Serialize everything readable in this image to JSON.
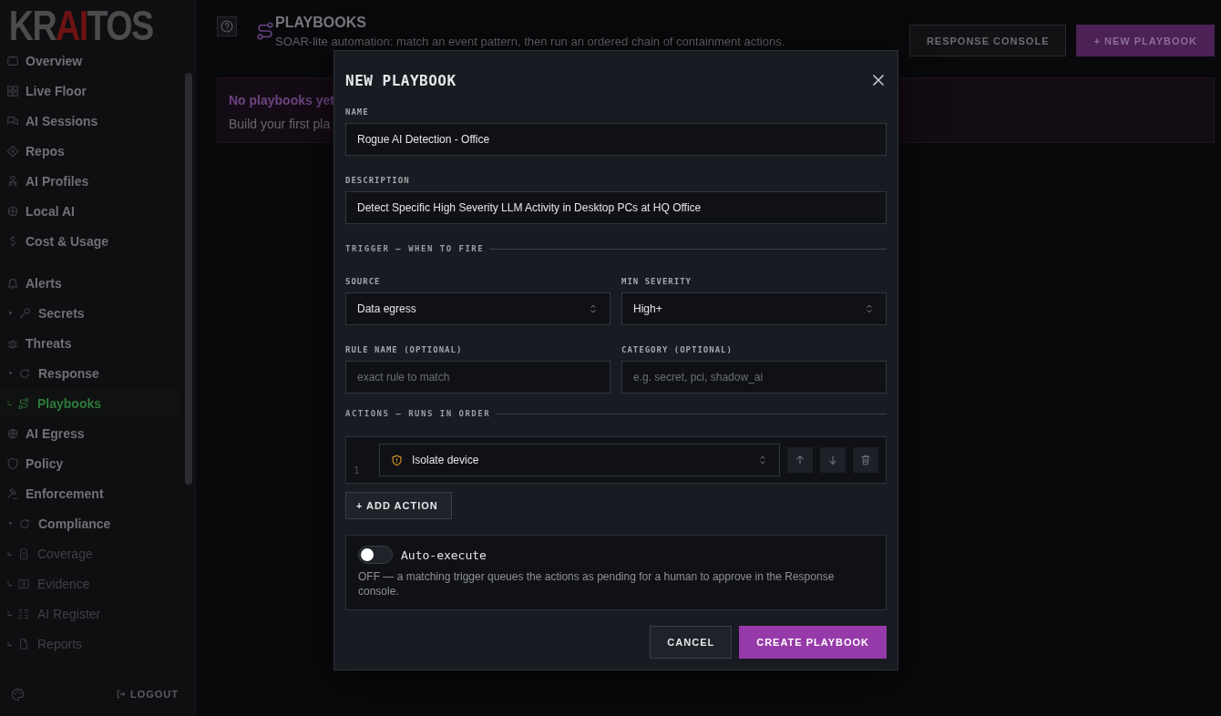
{
  "logo": {
    "parts": [
      {
        "text": "KR",
        "accent": false
      },
      {
        "text": "AI",
        "accent": true
      },
      {
        "text": "TOS",
        "accent": false
      }
    ]
  },
  "sidebar": {
    "sections": [
      {
        "items": [
          {
            "label": "Overview",
            "kind": "item",
            "selected": false
          },
          {
            "label": "Live Floor",
            "kind": "item",
            "selected": false
          },
          {
            "label": "AI Sessions",
            "kind": "item",
            "selected": false
          },
          {
            "label": "Repos",
            "kind": "item",
            "selected": false
          },
          {
            "label": "AI Profiles",
            "kind": "item",
            "selected": false
          },
          {
            "label": "Local AI",
            "kind": "item",
            "selected": false
          },
          {
            "label": "Cost & Usage",
            "kind": "item",
            "selected": false
          }
        ]
      },
      {
        "items": [
          {
            "label": "Alerts",
            "kind": "item",
            "selected": false
          },
          {
            "label": "Secrets",
            "kind": "group",
            "selected": false,
            "expanded": false
          },
          {
            "label": "Threats",
            "kind": "item",
            "selected": false
          },
          {
            "label": "Response",
            "kind": "group",
            "selected": false,
            "expanded": true
          },
          {
            "label": "Playbooks",
            "kind": "child",
            "selected": true
          },
          {
            "label": "AI Egress",
            "kind": "item",
            "selected": false
          },
          {
            "label": "Policy",
            "kind": "item",
            "selected": false
          },
          {
            "label": "Enforcement",
            "kind": "item",
            "selected": false
          },
          {
            "label": "Compliance",
            "kind": "group",
            "selected": false,
            "expanded": true
          },
          {
            "label": "Coverage",
            "kind": "child",
            "selected": false
          },
          {
            "label": "Evidence",
            "kind": "child",
            "selected": false
          },
          {
            "label": "AI Register",
            "kind": "child",
            "selected": false
          },
          {
            "label": "Reports",
            "kind": "child",
            "selected": false
          }
        ]
      }
    ],
    "logout": "LOGOUT"
  },
  "header": {
    "title": "PLAYBOOKS",
    "subtitle": "SOAR-lite automation: match an event pattern, then run an ordered chain of containment actions.",
    "buttons": [
      {
        "label": "RESPONSE CONSOLE",
        "kind": "secondary"
      },
      {
        "label": "+ NEW PLAYBOOK",
        "kind": "primary"
      }
    ]
  },
  "banner": {
    "title": "No playbooks yet",
    "text": "Build your first pla"
  },
  "dialog": {
    "title": "NEW PLAYBOOK",
    "name": {
      "label": "NAME",
      "value": "Rogue AI Detection - Office"
    },
    "description": {
      "label": "DESCRIPTION",
      "value": "Detect Specific High Severity LLM Activity in Desktop PCs at HQ Office"
    },
    "trigger_heading": "TRIGGER — WHEN TO FIRE",
    "trigger_fields": [
      {
        "label": "SOURCE",
        "kind": "select",
        "value": "Data egress"
      },
      {
        "label": "MIN SEVERITY",
        "kind": "select",
        "value": "High+"
      },
      {
        "label": "RULE NAME (OPTIONAL)",
        "kind": "text",
        "placeholder": "exact rule to match"
      },
      {
        "label": "CATEGORY (OPTIONAL)",
        "kind": "text",
        "placeholder": "e.g. secret, pci, shadow_ai"
      }
    ],
    "actions_heading": "ACTIONS — RUNS IN ORDER",
    "actions": [
      {
        "number": "1",
        "value": "Isolate device"
      }
    ],
    "add_action": "+ ADD ACTION",
    "auto_execute": {
      "label": "Auto-execute",
      "on": false,
      "note": "OFF — a matching trigger queues the actions as pending for a human to approve in the Response console."
    },
    "buttons": [
      {
        "label": "CANCEL",
        "kind": "secondary"
      },
      {
        "label": "CREATE PLAYBOOK",
        "kind": "primary"
      }
    ]
  }
}
